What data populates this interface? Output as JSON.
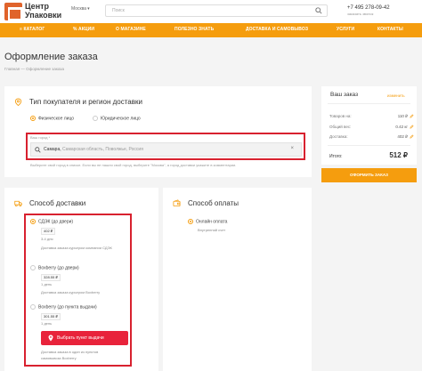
{
  "header": {
    "logo_line1": "Центр",
    "logo_line2": "Упаковки",
    "city": "Москва",
    "search_placeholder": "Поиск",
    "phone": "+7 495 278-09-42",
    "callback": "заказать звонок"
  },
  "nav": [
    "≡ КАТАЛОГ",
    "% АКЦИИ",
    "О МАГАЗИНЕ",
    "ПОЛЕЗНО ЗНАТЬ",
    "ДОСТАВКА И САМОВЫВОЗ",
    "УСЛУГИ",
    "КОНТАКТЫ"
  ],
  "page": {
    "title": "Оформление заказа",
    "breadcrumbs": "Главная — Оформление заказа"
  },
  "buyer": {
    "title": "Тип покупателя и регион доставки",
    "options": [
      "Физическое лицо",
      "Юридическое лицо"
    ],
    "selected": 0,
    "city_label": "Ваш город *",
    "city_value": "Самара,",
    "city_rest": " Самарская область, Поволжье, Россия",
    "city_hint": "Выберите свой город в списке. Если вы не нашли свой город, выберите \"Москва\", а город доставки укажите в комментарии."
  },
  "delivery": {
    "title": "Способ доставки",
    "options": [
      {
        "name": "СДЭК (до двери)",
        "price": "402 ₽",
        "term": "3-4 дня",
        "desc": "Доставка заказа курьером компании СДЭК",
        "selected": true
      },
      {
        "name": "Boxberry (до двери)",
        "price": "328.55 ₽",
        "term": "1 день",
        "desc": "Доставка заказа курьером Boxberry",
        "selected": false
      },
      {
        "name": "Boxberry (до пункта выдачи)",
        "price": "301.55 ₽",
        "term": "1 день",
        "desc": "",
        "selected": false
      }
    ],
    "pick_button": "Выбрать пункт выдачи",
    "pick_desc_1": "Доставка заказа в один из пунктов",
    "pick_desc_2": "самовывоза Boxberry"
  },
  "payment": {
    "title": "Способ оплаты",
    "option": "Онлайн оплата",
    "option_desc": "Внутренний счет"
  },
  "order": {
    "title": "Ваш заказ",
    "edit": "изменить",
    "rows": [
      {
        "label": "Товаров на:",
        "value": "110 ₽"
      },
      {
        "label": "Общий вес:",
        "value": "0.42 кг"
      },
      {
        "label": "Доставка:",
        "value": "402 ₽"
      }
    ],
    "total_label": "Итого:",
    "total_value": "512 ₽",
    "submit": "ОФОРМИТЬ ЗАКАЗ"
  },
  "colors": {
    "accent": "#f59d0e",
    "highlight": "#d8212f",
    "button_red": "#e8233b",
    "logo": "#e0632b"
  }
}
